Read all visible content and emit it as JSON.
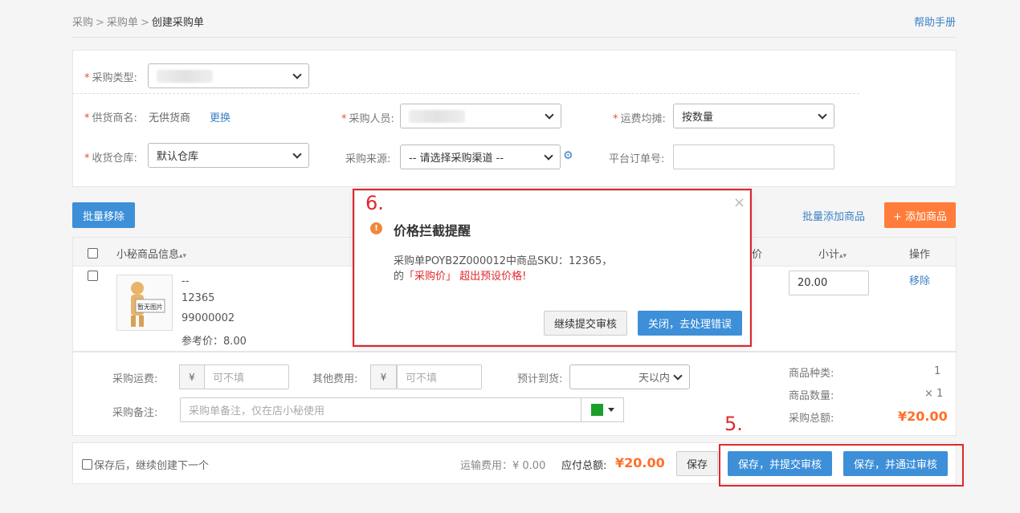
{
  "breadcrumb": {
    "items": [
      "采购",
      "采购单"
    ],
    "separator": ">",
    "current": "创建采购单"
  },
  "help": {
    "label": "帮助手册"
  },
  "form": {
    "purchase_type": {
      "label": "采购类型:"
    },
    "supplier": {
      "label": "供货商名:",
      "value": "无供货商",
      "change_link": "更换"
    },
    "buyer": {
      "label": "采购人员:"
    },
    "freight_split": {
      "label": "运费均摊:",
      "value": "按数量"
    },
    "warehouse": {
      "label": "收货仓库:",
      "value": "默认仓库"
    },
    "source": {
      "label": "采购来源:",
      "value": "-- 请选择采购渠道 --"
    },
    "platform_order": {
      "label": "平台订单号:",
      "value": ""
    }
  },
  "toolbar": {
    "batch_remove": "批量移除",
    "batch_add": "批量添加商品",
    "add_product": "+ 添加商品"
  },
  "table": {
    "headers": {
      "product_info": "小秘商品信息",
      "sort": "▴▾",
      "price_col": "价",
      "subtotal": "小计",
      "ops": "操作"
    },
    "rows": [
      {
        "image_text": "暂无图片",
        "name": "--",
        "sku": "12365",
        "code": "99000002",
        "ref_price": "参考价：8.00",
        "subtotal": "20.00",
        "remove": "移除"
      }
    ]
  },
  "fees": {
    "shipping": {
      "label": "采购运费:",
      "currency": "¥",
      "placeholder": "可不填"
    },
    "other": {
      "label": "其他费用:",
      "currency": "¥",
      "placeholder": "可不填"
    },
    "eta": {
      "label": "预计到货:",
      "value": "天以内"
    },
    "remark": {
      "label": "采购备注:",
      "placeholder": "采购单备注，仅在店小秘使用"
    },
    "flag_color": "#1a9f2b"
  },
  "summary": {
    "kinds_label": "商品种类:",
    "kinds_value": "1",
    "qty_label": "商品数量:",
    "qty_value": "× 1",
    "total_label": "采购总额:",
    "total_value": "¥20.00"
  },
  "footer": {
    "continue_label": "保存后，继续创建下一个",
    "shipping_fee": "运输费用：¥ 0.00",
    "payable_label": "应付总额:",
    "payable_value": "¥20.00",
    "save": "保存",
    "save_submit": "保存，并提交审核",
    "save_approve": "保存，并通过审核"
  },
  "annotations": {
    "five": "5.",
    "six": "6."
  },
  "modal": {
    "title": "价格拦截提醒",
    "warn_glyph": "!",
    "line1": "采购单POYB2Z000012中商品SKU：12365，",
    "line2_prefix": "的",
    "line2_highlight": "「采购价」 超出预设价格!",
    "continue_button": "继续提交审核",
    "close_button": "关闭，去处理错误",
    "close_icon": "×"
  },
  "colors": {
    "accent": "#3d8fd8",
    "orange": "#ff7c3a",
    "annotation": "#e0282e",
    "price": "#ff6f28"
  }
}
